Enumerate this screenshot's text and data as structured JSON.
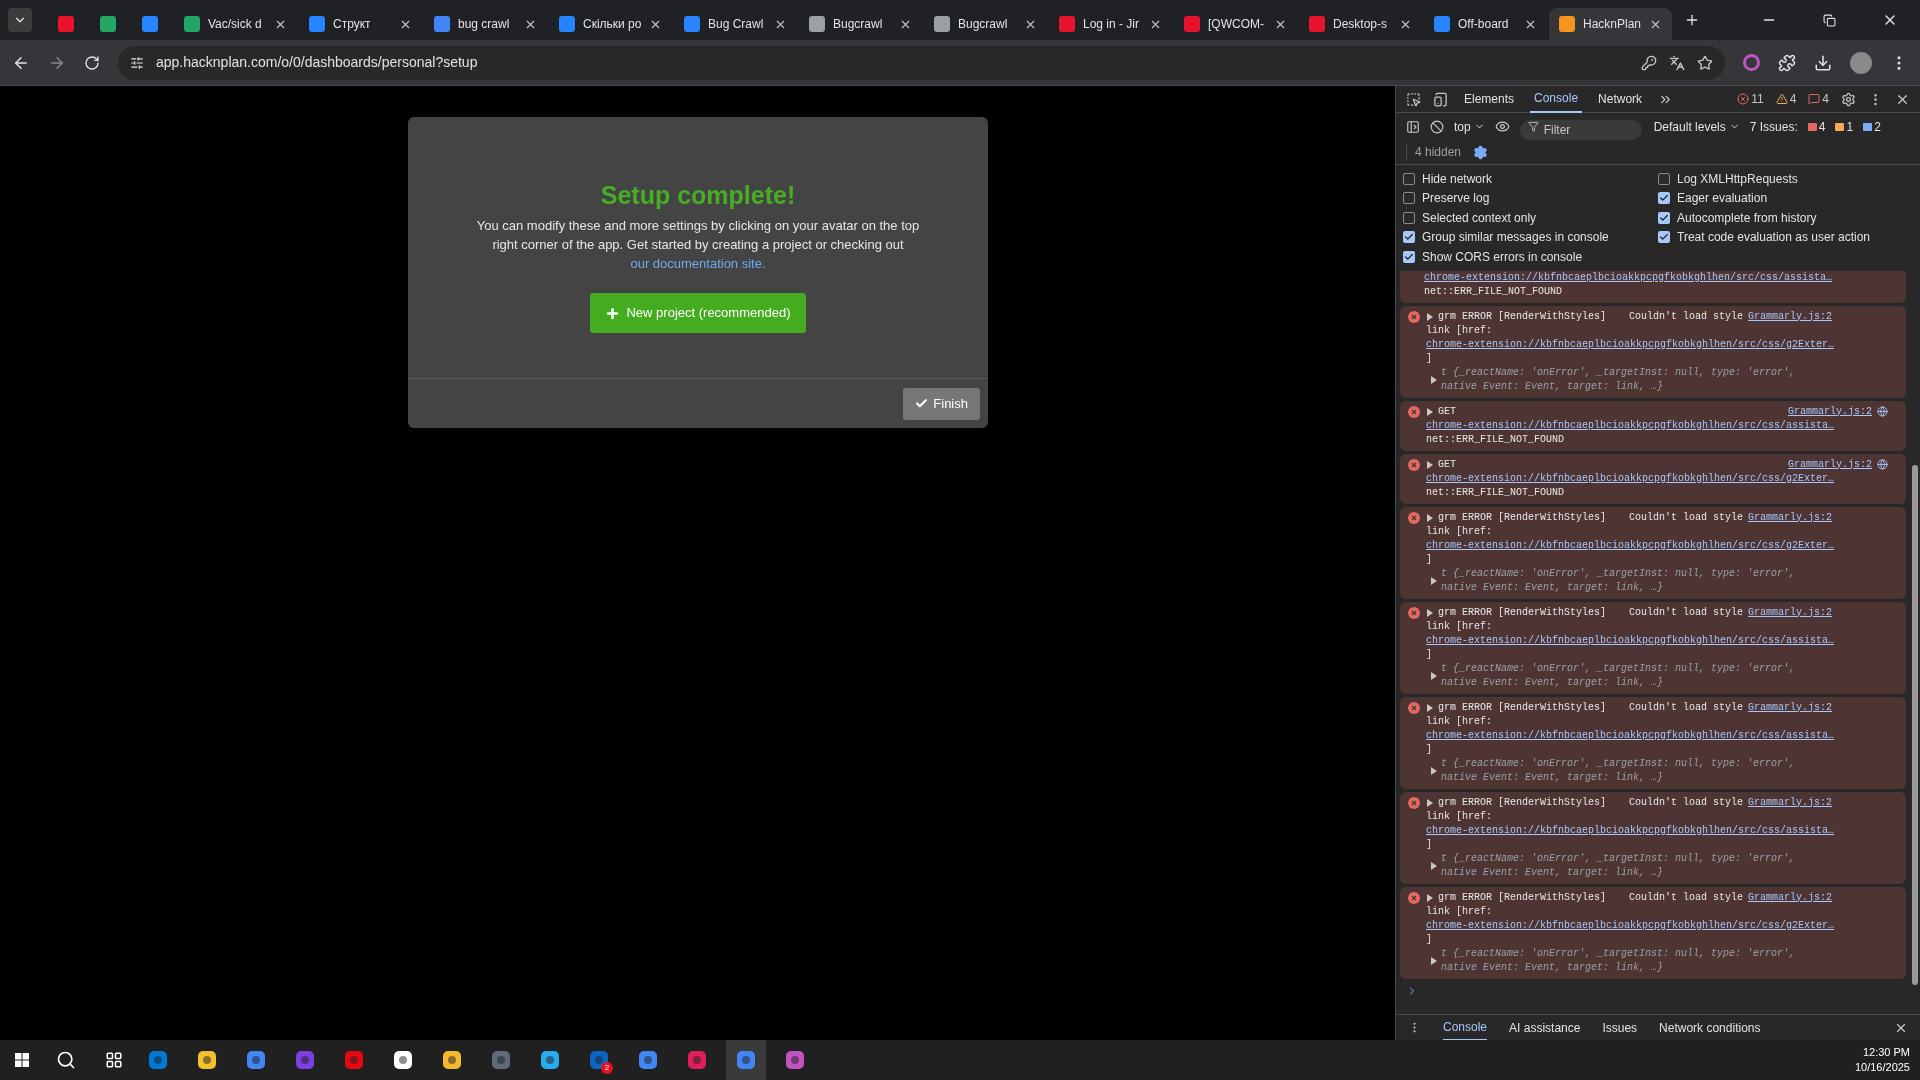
{
  "browser": {
    "tabs": [
      {
        "color": "#e8132c",
        "selected": false
      },
      {
        "color": "#23a566",
        "selected": false
      },
      {
        "color": "#2684ff",
        "selected": false
      },
      {
        "title": "Vac/sick d",
        "color": "#23a566",
        "selected": false
      },
      {
        "title": "Структ",
        "color": "#2684ff",
        "selected": false
      },
      {
        "title": "bug crawl",
        "color": "#4285f4",
        "selected": false
      },
      {
        "title": "Скільки ро",
        "color": "#2684ff",
        "selected": false
      },
      {
        "title": "Bug Crawl",
        "color": "#2684ff",
        "selected": false
      },
      {
        "title": "Bugcrawl",
        "color": "#9aa0a6",
        "selected": false
      },
      {
        "title": "Bugcrawl",
        "color": "#9aa0a6",
        "selected": false
      },
      {
        "title": "Log in - Jir",
        "color": "#e8132c",
        "selected": false
      },
      {
        "title": "[QWCOM-",
        "color": "#e8132c",
        "selected": false
      },
      {
        "title": "Desktop-s",
        "color": "#e8132c",
        "selected": false
      },
      {
        "title": "Off-board",
        "color": "#2684ff",
        "selected": false
      },
      {
        "title": "HacknPlan",
        "color": "#f7941d",
        "selected": true
      }
    ],
    "address": "app.hacknplan.com/o/0/dashboards/personal?setup"
  },
  "modal": {
    "title": "Setup complete!",
    "text": "You can modify these and more settings by clicking on your avatar on the top right corner of the app. Get started by creating a project or checking out",
    "link": "our documentation site.",
    "primary_button": "New project (recommended)",
    "finish_button": "Finish"
  },
  "devtools": {
    "tabs": [
      {
        "label": "Elements",
        "selected": false
      },
      {
        "label": "Console",
        "selected": true
      },
      {
        "label": "Network",
        "selected": false
      }
    ],
    "counts": {
      "errors": "11",
      "warnings": "4",
      "issues": "4"
    },
    "context": "top",
    "filter_placeholder": "Filter",
    "levels": "Default levels",
    "issues_label": "7 Issues:",
    "issue_counts": [
      "4",
      "1",
      "2"
    ],
    "hidden": "4 hidden",
    "settings_left": [
      {
        "label": "Hide network",
        "checked": false
      },
      {
        "label": "Preserve log",
        "checked": false
      },
      {
        "label": "Selected context only",
        "checked": false
      },
      {
        "label": "Group similar messages in console",
        "checked": true
      },
      {
        "label": "Show CORS errors in console",
        "checked": true
      }
    ],
    "settings_right": [
      {
        "label": "Log XMLHttpRequests",
        "checked": false
      },
      {
        "label": "Eager evaluation",
        "checked": true
      },
      {
        "label": "Autocomplete from history",
        "checked": true
      },
      {
        "label": "Treat code evaluation as user action",
        "checked": true
      }
    ],
    "messages": [
      {
        "kind": "tail",
        "url": "chrome-extension://kbfnbcaeplbcioakkpcpgfkobkghlhen/src/css/assista…",
        "detail": "net::ERR_FILE_NOT_FOUND"
      },
      {
        "kind": "style",
        "head": "grm ERROR [RenderWithStyles]",
        "text": "Couldn't load style",
        "source": "Grammarly.js:2",
        "href": "link [href:",
        "url": "chrome-extension://kbfnbcaeplbcioakkpcpgfkobkghlhen/src/css/g2Exter…",
        "close": "]",
        "object": "t {_reactName: 'onError', _targetInst: null, type: 'error', native Event: Event, target: link, …}"
      },
      {
        "kind": "get",
        "head": "GET",
        "source": "Grammarly.js:2",
        "url": "chrome-extension://kbfnbcaeplbcioakkpcpgfkobkghlhen/src/css/assista…",
        "detail": "net::ERR_FILE_NOT_FOUND"
      },
      {
        "kind": "get",
        "head": "GET",
        "source": "Grammarly.js:2",
        "url": "chrome-extension://kbfnbcaeplbcioakkpcpgfkobkghlhen/src/css/g2Exter…",
        "detail": "net::ERR_FILE_NOT_FOUND"
      },
      {
        "kind": "style",
        "head": "grm ERROR [RenderWithStyles]",
        "text": "Couldn't load style",
        "source": "Grammarly.js:2",
        "href": "link [href:",
        "url": "chrome-extension://kbfnbcaeplbcioakkpcpgfkobkghlhen/src/css/g2Exter…",
        "close": "]",
        "object": "t {_reactName: 'onError', _targetInst: null, type: 'error', native Event: Event, target: link, …}"
      },
      {
        "kind": "style",
        "head": "grm ERROR [RenderWithStyles]",
        "text": "Couldn't load style",
        "source": "Grammarly.js:2",
        "href": "link [href:",
        "url": "chrome-extension://kbfnbcaeplbcioakkpcpgfkobkghlhen/src/css/assista…",
        "close": "]",
        "object": "t {_reactName: 'onError', _targetInst: null, type: 'error', native Event: Event, target: link, …}"
      },
      {
        "kind": "style",
        "head": "grm ERROR [RenderWithStyles]",
        "text": "Couldn't load style",
        "source": "Grammarly.js:2",
        "href": "link [href:",
        "url": "chrome-extension://kbfnbcaeplbcioakkpcpgfkobkghlhen/src/css/assista…",
        "close": "]",
        "object": "t {_reactName: 'onError', _targetInst: null, type: 'error', native Event: Event, target: link, …}"
      },
      {
        "kind": "style",
        "head": "grm ERROR [RenderWithStyles]",
        "text": "Couldn't load style",
        "source": "Grammarly.js:2",
        "href": "link [href:",
        "url": "chrome-extension://kbfnbcaeplbcioakkpcpgfkobkghlhen/src/css/assista…",
        "close": "]",
        "object": "t {_reactName: 'onError', _targetInst: null, type: 'error', native Event: Event, target: link, …}"
      },
      {
        "kind": "style",
        "head": "grm ERROR [RenderWithStyles]",
        "text": "Couldn't load style",
        "source": "Grammarly.js:2",
        "href": "link [href:",
        "url": "chrome-extension://kbfnbcaeplbcioakkpcpgfkobkghlhen/src/css/g2Exter…",
        "close": "]",
        "object": "t {_reactName: 'onError', _targetInst: null, type: 'error', native Event: Event, target: link, …}"
      }
    ],
    "drawer_tabs": [
      {
        "label": "Console",
        "selected": true
      },
      {
        "label": "AI assistance",
        "selected": false
      },
      {
        "label": "Issues",
        "selected": false
      },
      {
        "label": "Network conditions",
        "selected": false
      }
    ]
  },
  "taskbar": {
    "apps": [
      {
        "color": "#0078d4",
        "selected": false
      },
      {
        "color": "#f2c12e",
        "selected": false
      },
      {
        "color": "#4285f4",
        "selected": false
      },
      {
        "color": "#7b3fe4",
        "selected": false
      },
      {
        "color": "#e50914",
        "selected": false
      },
      {
        "color": "#ffffff",
        "selected": false
      },
      {
        "color": "#f3ba2f",
        "selected": false
      },
      {
        "color": "#5f6b7a",
        "selected": false
      },
      {
        "color": "#2aabee",
        "selected": false
      },
      {
        "color": "#0a66c2",
        "selected": false,
        "badge": "2"
      },
      {
        "color": "#4285f4",
        "selected": false
      },
      {
        "color": "#e01e5a",
        "selected": false
      },
      {
        "color": "#4285f4",
        "selected": true
      },
      {
        "color": "#c154c1",
        "selected": false
      }
    ],
    "time": "12:30 PM",
    "date": "10/16/2025"
  }
}
